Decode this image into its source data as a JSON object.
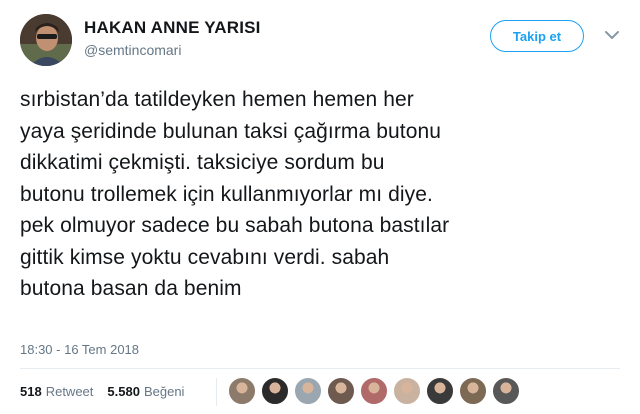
{
  "user": {
    "display_name": "HAKAN ANNE YARISI",
    "handle": "@semtincomari",
    "avatar_icon": "profile-photo"
  },
  "follow_button": {
    "label": "Takip et",
    "accent_color": "#1da1f2"
  },
  "menu": {
    "icon": "chevron-down-icon"
  },
  "tweet": {
    "lines": [
      "sırbistan’da tatildeyken hemen hemen her",
      "yaya şeridinde bulunan taksi çağırma butonu",
      "dikkatimi çekmişti. taksiciye sordum bu",
      "butonu trollemek için kullanmıyorlar mı diye.",
      "pek olmuyor sadece bu sabah butona bastılar",
      "gittik kimse yoktu cevabını verdi. sabah",
      "butona basan da benim"
    ],
    "timestamp": "18:30 - 16 Tem 2018"
  },
  "stats": {
    "retweet_count": "518",
    "retweet_label": "Retweet",
    "like_count": "5.580",
    "like_label": "Beğeni"
  },
  "likers": {
    "colors": [
      "#8c7a6b",
      "#2b2b2b",
      "#9aa7b0",
      "#6e5a4e",
      "#b06a6a",
      "#c9b3a0",
      "#3a3a3a",
      "#7d6a55",
      "#585858"
    ]
  }
}
